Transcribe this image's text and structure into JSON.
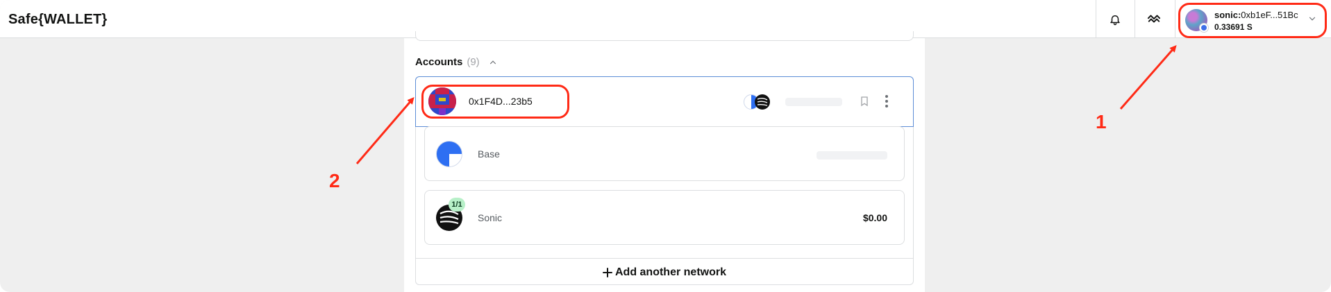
{
  "header": {
    "app_title": "Safe{WALLET}",
    "account": {
      "chain_prefix": "sonic:",
      "address": "0xb1eF...51Bc",
      "balance": "0.33691 S"
    }
  },
  "accounts_section": {
    "title": "Accounts",
    "count": "(9)",
    "safe": {
      "address": "0x1F4D...23b5"
    },
    "networks": [
      {
        "name": "Base",
        "value": "",
        "threshold": ""
      },
      {
        "name": "Sonic",
        "value": "$0.00",
        "threshold": "1/1"
      }
    ],
    "add_network_label": "Add another network"
  },
  "annotations": {
    "label_1": "1",
    "label_2": "2"
  },
  "colors": {
    "annotation_red": "#ff2a16",
    "selected_border": "#5b8cd6",
    "threshold_badge": "#b7f0c8",
    "base_blue": "#2e6ff2"
  },
  "icons": [
    "bell-icon",
    "waves-icon",
    "chevron-down-icon",
    "chevron-up-icon",
    "bookmark-icon",
    "kebab-menu-icon",
    "plus-icon",
    "base-chain-icon",
    "sonic-chain-icon"
  ]
}
